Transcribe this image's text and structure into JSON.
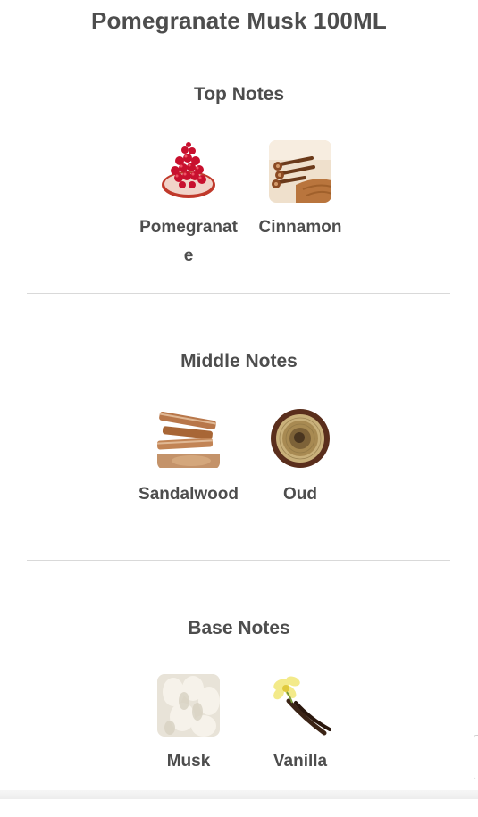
{
  "product": {
    "title": "Pomegranate Musk 100ML"
  },
  "sections": {
    "top": {
      "title": "Top Notes",
      "items": [
        {
          "label": "Pomegranate",
          "icon": "pomegranate-image"
        },
        {
          "label": "Cinnamon",
          "icon": "cinnamon-image"
        }
      ]
    },
    "middle": {
      "title": "Middle Notes",
      "items": [
        {
          "label": "Sandalwood",
          "icon": "sandalwood-image"
        },
        {
          "label": "Oud",
          "icon": "oud-image"
        }
      ]
    },
    "base": {
      "title": "Base Notes",
      "items": [
        {
          "label": "Musk",
          "icon": "musk-image"
        },
        {
          "label": "Vanilla",
          "icon": "vanilla-image"
        }
      ]
    }
  },
  "colors": {
    "text": "#4d4d4d",
    "divider": "#d9d9d9",
    "background": "#ffffff"
  }
}
